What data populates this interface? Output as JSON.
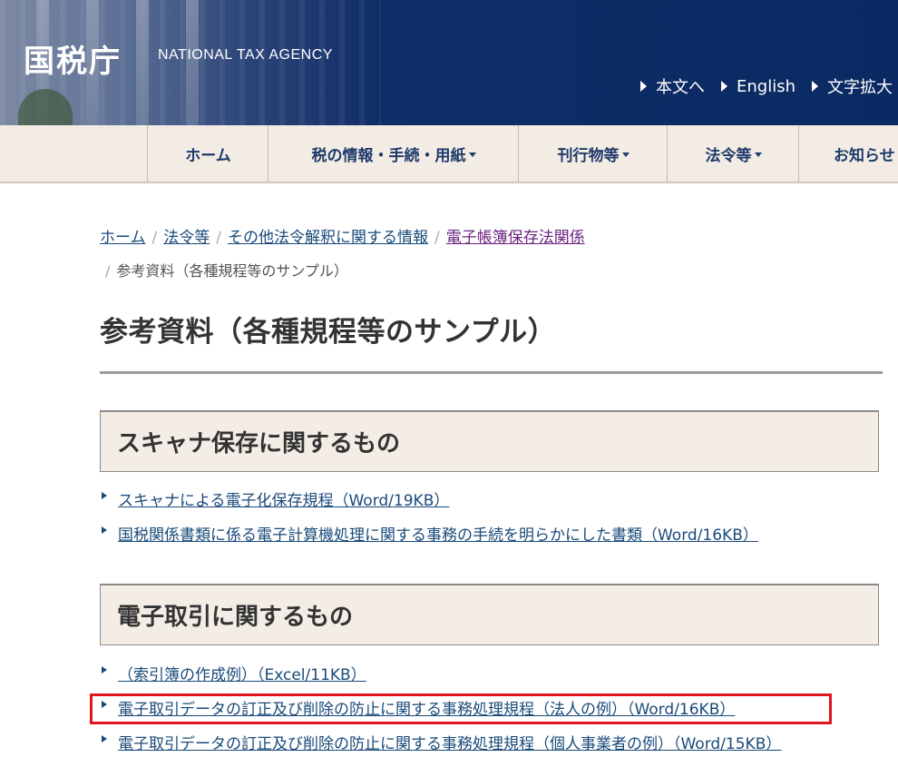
{
  "header": {
    "logo": "国税庁",
    "logo_sub": "NATIONAL TAX AGENCY",
    "util_links": [
      "本文へ",
      "English",
      "文字拡大"
    ]
  },
  "nav": {
    "items": [
      {
        "label": "ホーム",
        "dropdown": false
      },
      {
        "label": "税の情報・手続・用紙",
        "dropdown": true
      },
      {
        "label": "刊行物等",
        "dropdown": true
      },
      {
        "label": "法令等",
        "dropdown": true
      },
      {
        "label": "お知らせ",
        "dropdown": false
      }
    ]
  },
  "breadcrumb": {
    "items": [
      "ホーム",
      "法令等",
      "その他法令解釈に関する情報",
      "電子帳簿保存法関係"
    ],
    "current": "参考資料（各種規程等のサンプル）",
    "separator": "/"
  },
  "page": {
    "title": "参考資料（各種規程等のサンプル）"
  },
  "sections": [
    {
      "heading": "スキャナ保存に関するもの",
      "links": [
        "スキャナによる電子化保存規程（Word/19KB）",
        "国税関係書類に係る電子計算機処理に関する事務の手続を明らかにした書類（Word/16KB）"
      ]
    },
    {
      "heading": "電子取引に関するもの",
      "links": [
        "（索引簿の作成例）（Excel/11KB）",
        "電子取引データの訂正及び削除の防止に関する事務処理規程（法人の例）（Word/16KB）",
        "電子取引データの訂正及び削除の防止に関する事務処理規程（個人事業者の例）（Word/15KB）"
      ]
    }
  ],
  "colors": {
    "header_bg": "#0f2d66",
    "nav_bg": "#f2ece4",
    "link": "#1a4a7a",
    "visited": "#6b2380",
    "highlight": "#e0161e"
  }
}
